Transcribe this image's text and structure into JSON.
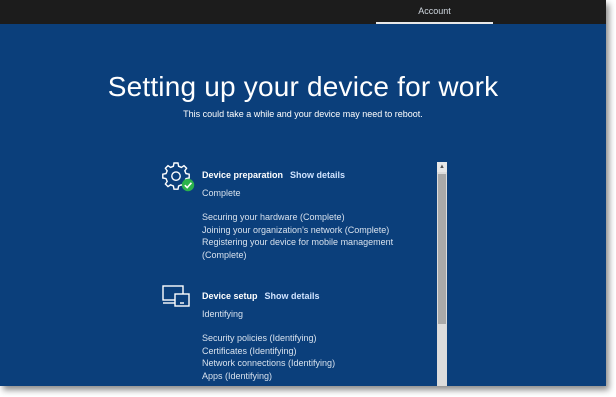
{
  "topbar": {
    "account_tab": "Account"
  },
  "page": {
    "title": "Setting up your device for work",
    "subtitle": "This could take a while and your device may need to reboot."
  },
  "sections": [
    {
      "icon": "gear-check-icon",
      "title": "Device preparation",
      "link": "Show details",
      "status": "Complete",
      "items": [
        "Securing your hardware (Complete)",
        "Joining your organization's network (Complete)",
        "Registering your device for mobile management",
        "(Complete)"
      ]
    },
    {
      "icon": "devices-icon",
      "title": "Device setup",
      "link": "Show details",
      "status": "Identifying",
      "items": [
        "Security policies (Identifying)",
        "Certificates (Identifying)",
        "Network connections (Identifying)",
        "Apps (Identifying)"
      ]
    }
  ],
  "colors": {
    "background": "#0b3f7b",
    "topbar": "#1c1c1c",
    "check_badge": "#2bb24c"
  }
}
